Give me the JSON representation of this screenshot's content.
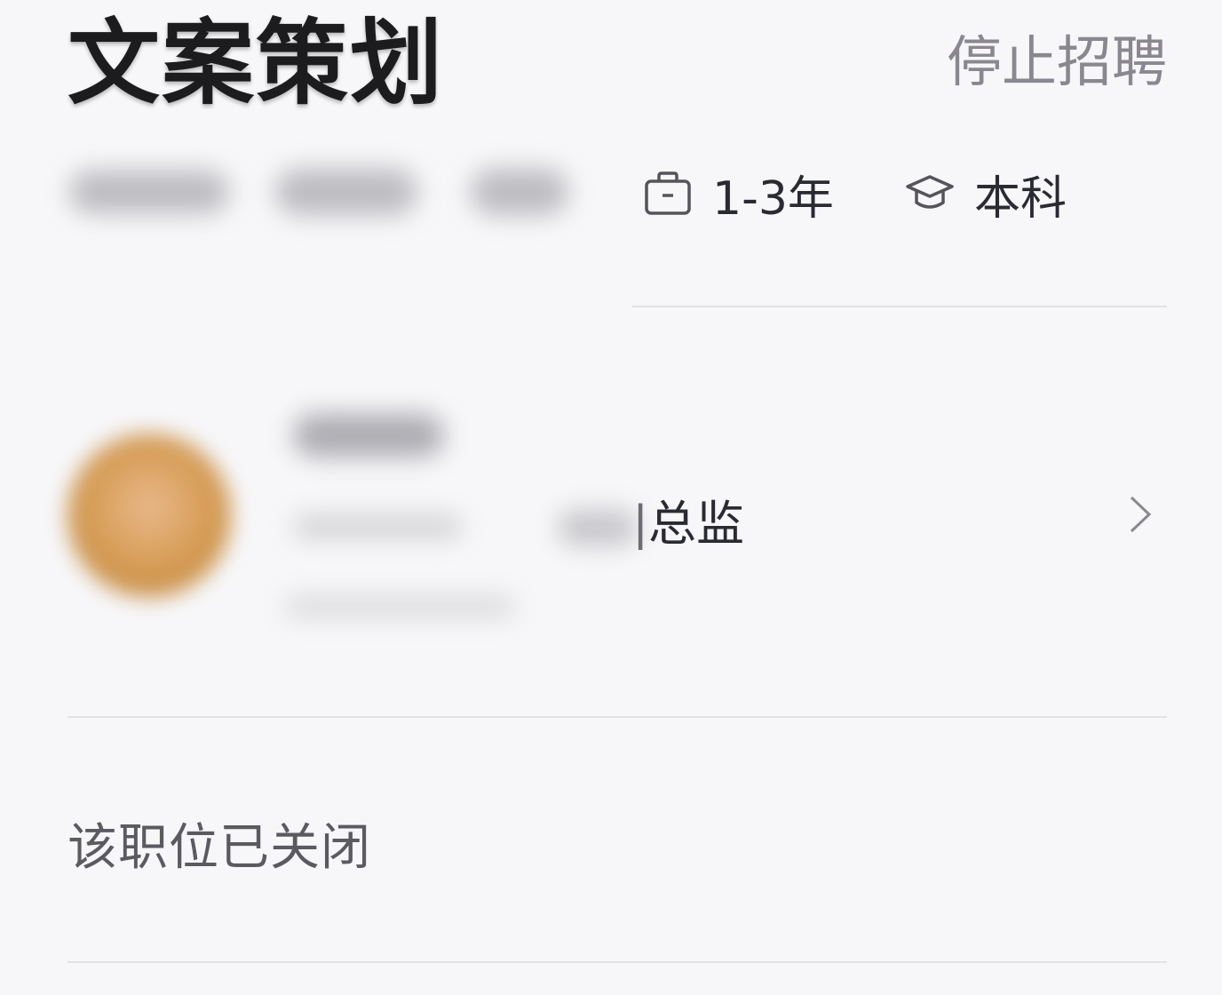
{
  "header": {
    "job_title": "文案策划",
    "stop_recruiting": "停止招聘"
  },
  "requirements": {
    "experience": {
      "icon": "briefcase-icon",
      "label": "1-3年"
    },
    "education": {
      "icon": "graduation-cap-icon",
      "label": "本科"
    }
  },
  "recruiter": {
    "title_suffix": "总监"
  },
  "status": {
    "closed_message": "该职位已关闭"
  }
}
